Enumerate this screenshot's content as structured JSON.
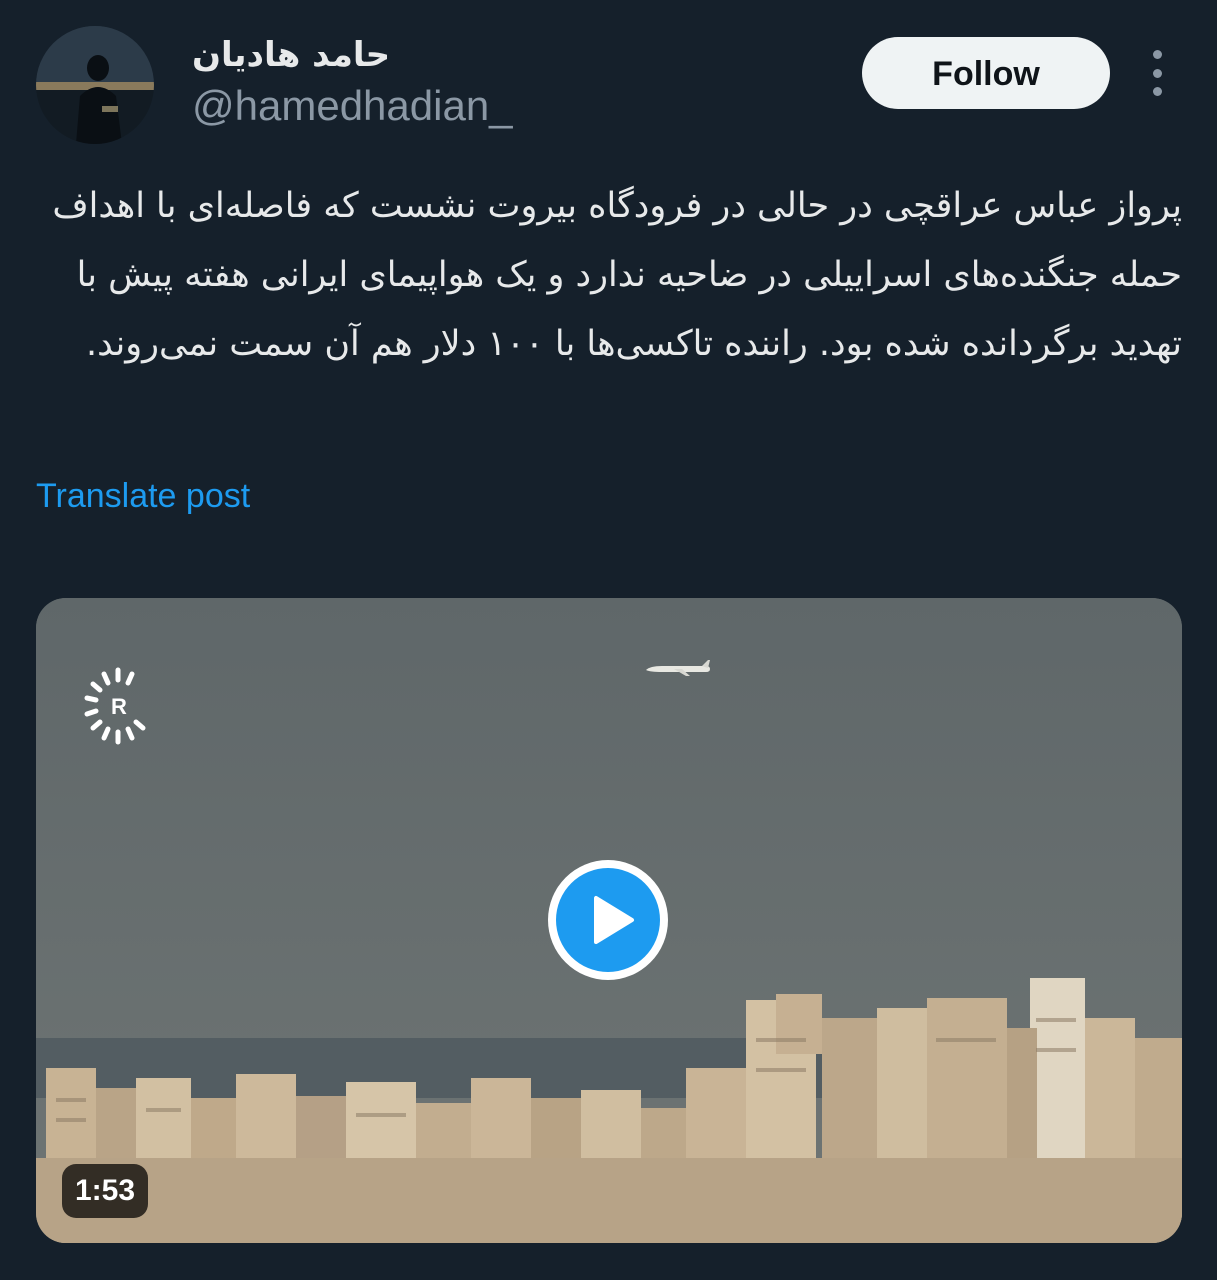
{
  "author": {
    "display_name": "حامد هادیان",
    "handle": "@hamedhadian_"
  },
  "actions": {
    "follow_label": "Follow",
    "more_icon": "more-vertical-icon"
  },
  "post": {
    "text": "پرواز عباس عراقچی در حالی در فرودگاه بیروت نشست که فاصله‌ای با اهداف حمله جنگنده‌های اسراییلی در ضاحیه ندارد و یک هواپیمای ایرانی هفته پیش با تهدید برگردانده شده بود. راننده تاکسی‌ها با ۱۰۰ دلار هم آن سمت نمی‌روند.",
    "translate_label": "Translate post"
  },
  "media": {
    "logo_letter": "R",
    "duration": "1:53",
    "play_icon": "play-icon"
  },
  "colors": {
    "background": "#15202b",
    "accent": "#1d9bf0",
    "text": "#e7e9ea",
    "secondary_text": "#8b98a5"
  }
}
